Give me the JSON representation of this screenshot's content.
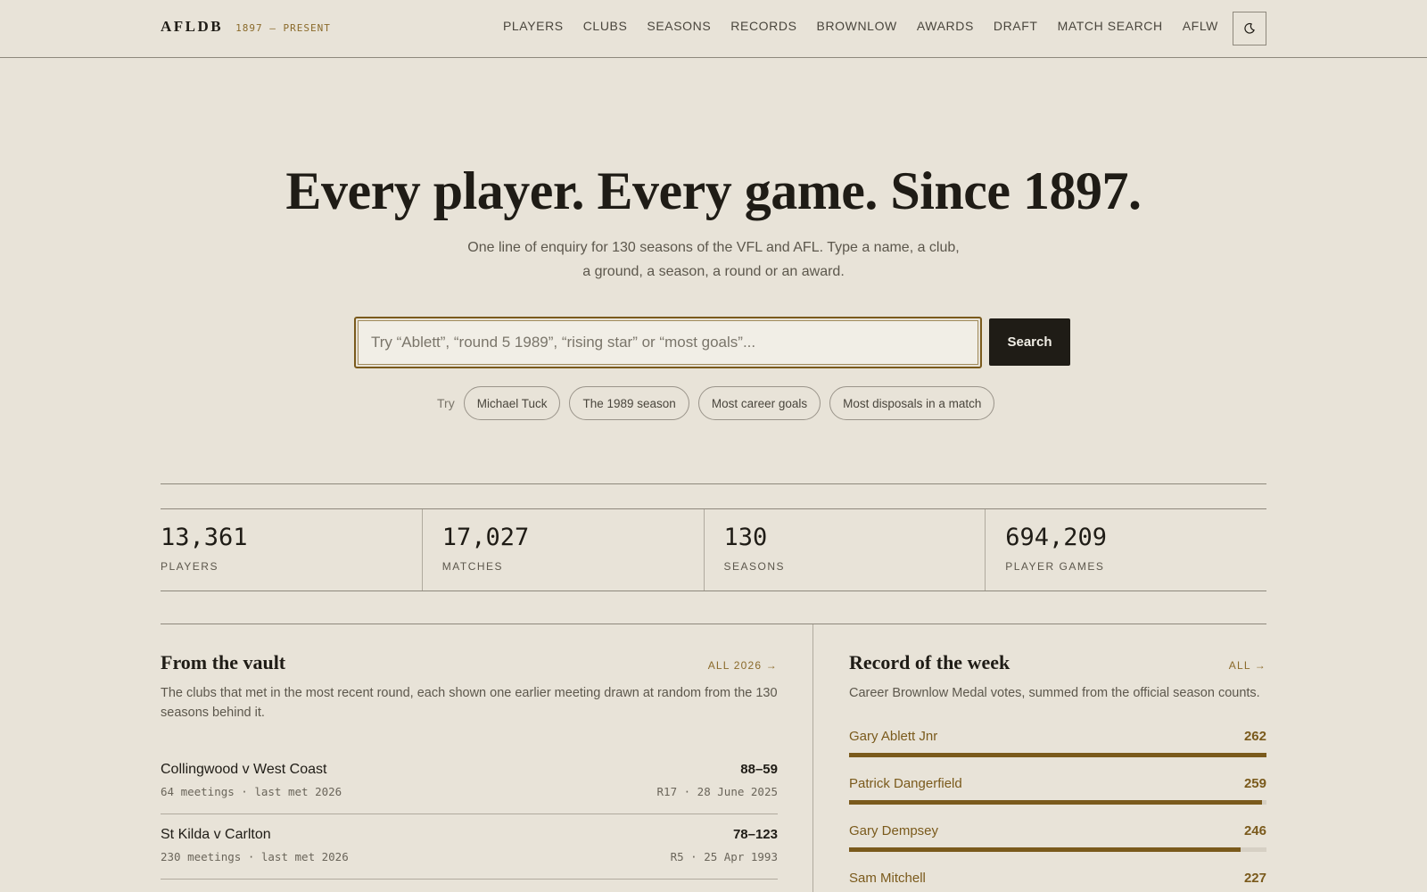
{
  "header": {
    "brand": "AFLDB",
    "years": "1897 — PRESENT",
    "nav": [
      "PLAYERS",
      "CLUBS",
      "SEASONS",
      "RECORDS",
      "BROWNLOW",
      "AWARDS",
      "DRAFT",
      "MATCH SEARCH",
      "AFLW"
    ],
    "theme_icon": "moon-icon"
  },
  "hero": {
    "title": "Every player. Every game. Since 1897.",
    "subtitle": "One line of enquiry for 130 seasons of the VFL and AFL. Type a name, a club, a ground, a season, a round or an award.",
    "search_placeholder": "Try “Ablett”, “round 5 1989”, “rising star” or “most goals”...",
    "search_button": "Search",
    "try_label": "Try",
    "suggestions": [
      "Michael Tuck",
      "The 1989 season",
      "Most career goals",
      "Most disposals in a match"
    ]
  },
  "stats": [
    {
      "value": "13,361",
      "label": "PLAYERS"
    },
    {
      "value": "17,027",
      "label": "MATCHES"
    },
    {
      "value": "130",
      "label": "SEASONS"
    },
    {
      "value": "694,209",
      "label": "PLAYER GAMES"
    }
  ],
  "vault": {
    "title": "From the vault",
    "link": "ALL 2026 →",
    "description": "The clubs that met in the most recent round, each shown one earlier meeting drawn at random from the 130 seasons behind it.",
    "rows": [
      {
        "teams": "Collingwood v West Coast",
        "meta": "64 meetings · last met 2026",
        "score": "88–59",
        "date": "R17 · 28 June 2025"
      },
      {
        "teams": "St Kilda v Carlton",
        "meta": "230 meetings · last met 2026",
        "score": "78–123",
        "date": "R5 · 25 Apr 1993"
      }
    ]
  },
  "record": {
    "title": "Record of the week",
    "link": "ALL →",
    "description": "Career Brownlow Medal votes, summed from the official season counts.",
    "max": 262,
    "rows": [
      {
        "name": "Gary Ablett Jnr",
        "value": 262
      },
      {
        "name": "Patrick Dangerfield",
        "value": 259
      },
      {
        "name": "Gary Dempsey",
        "value": 246
      },
      {
        "name": "Sam Mitchell",
        "value": 227
      }
    ]
  },
  "colors": {
    "background": "#e8e3d8",
    "accent": "#7a5a1c",
    "ink": "#1f1c16"
  }
}
